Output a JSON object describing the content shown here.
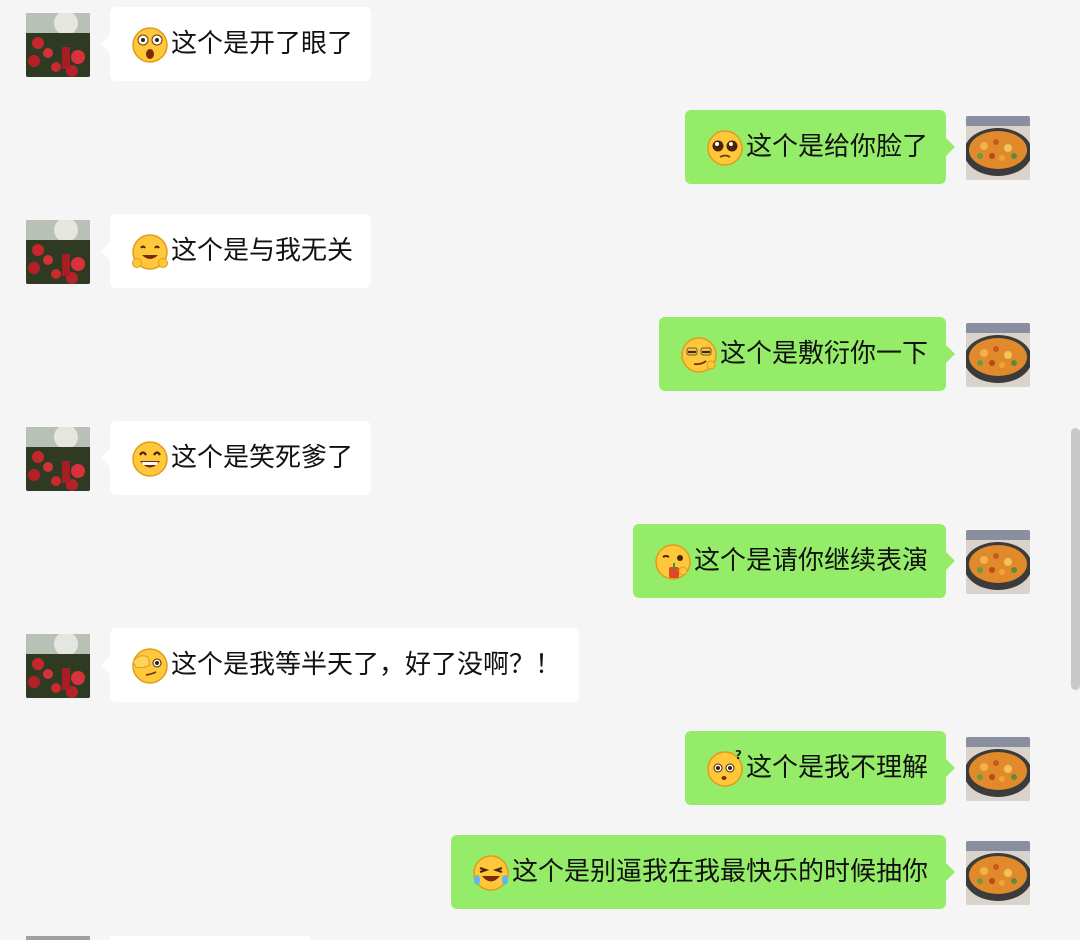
{
  "messages": [
    {
      "side": "in",
      "emoji": "mouth-open-eyes-wide-emoji",
      "text": "这个是开了眼了"
    },
    {
      "side": "out",
      "emoji": "pleading-face-emoji",
      "text": "这个是给你脸了"
    },
    {
      "side": "in",
      "emoji": "grin-hands-emoji",
      "text": "这个是与我无关"
    },
    {
      "side": "out",
      "emoji": "smirk-face-emoji",
      "text": "这个是敷衍你一下"
    },
    {
      "side": "in",
      "emoji": "big-grin-emoji",
      "text": "这个是笑死爹了"
    },
    {
      "side": "out",
      "emoji": "sipping-drink-emoji",
      "text": "这个是请你继续表演"
    },
    {
      "side": "in",
      "emoji": "hand-over-eye-emoji",
      "text": "这个是我等半天了，好了没啊？！"
    },
    {
      "side": "out",
      "emoji": "confused-question-emoji",
      "text": "这个是我不理解"
    },
    {
      "side": "out",
      "emoji": "crying-laughing-emoji",
      "text": "这个是别逼我在我最快乐的时候抽你"
    }
  ],
  "colors": {
    "background": "#f5f5f5",
    "incoming_bubble": "#ffffff",
    "outgoing_bubble": "#95ec69",
    "text": "#111111"
  }
}
